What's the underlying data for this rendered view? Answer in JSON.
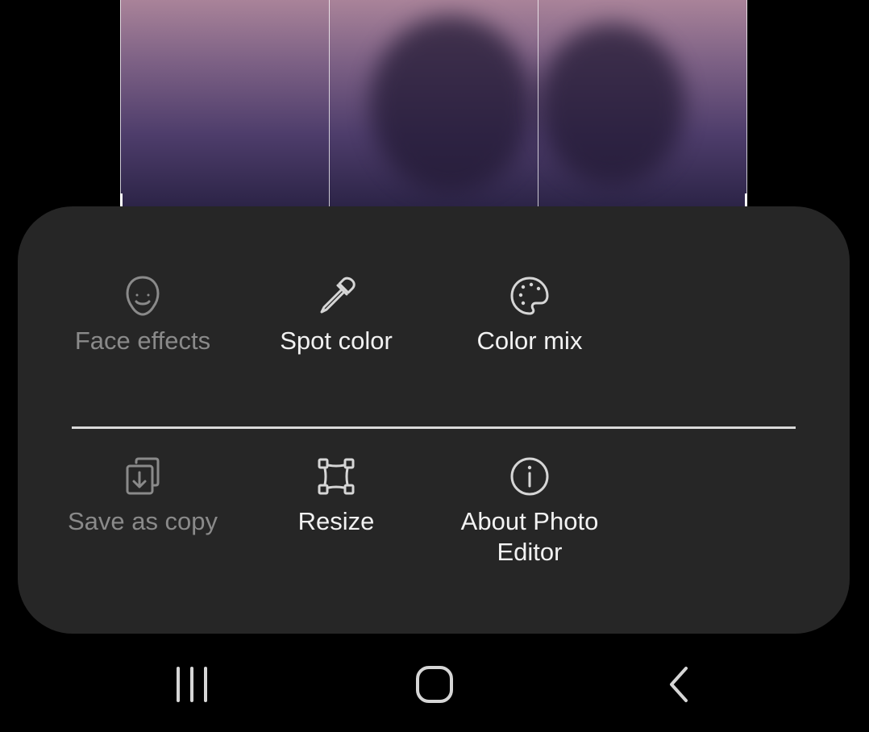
{
  "menu": {
    "row1": [
      {
        "icon": "face-icon",
        "label": "Face effects",
        "enabled": false
      },
      {
        "icon": "eyedropper-icon",
        "label": "Spot color",
        "enabled": true
      },
      {
        "icon": "palette-icon",
        "label": "Color mix",
        "enabled": true
      }
    ],
    "row2": [
      {
        "icon": "save-copy-icon",
        "label": "Save as copy",
        "enabled": false
      },
      {
        "icon": "resize-icon",
        "label": "Resize",
        "enabled": true
      },
      {
        "icon": "info-icon",
        "label": "About Photo Editor",
        "enabled": true
      }
    ]
  },
  "navbar": {
    "buttons": [
      "recent-apps-icon",
      "home-icon",
      "back-icon"
    ]
  },
  "colors": {
    "sheet_background": "#262626",
    "label_enabled": "#f2f2f2",
    "label_disabled": "#8a8a8a",
    "icon_enabled": "#d6d6d6",
    "icon_disabled": "#8a8a8a"
  }
}
